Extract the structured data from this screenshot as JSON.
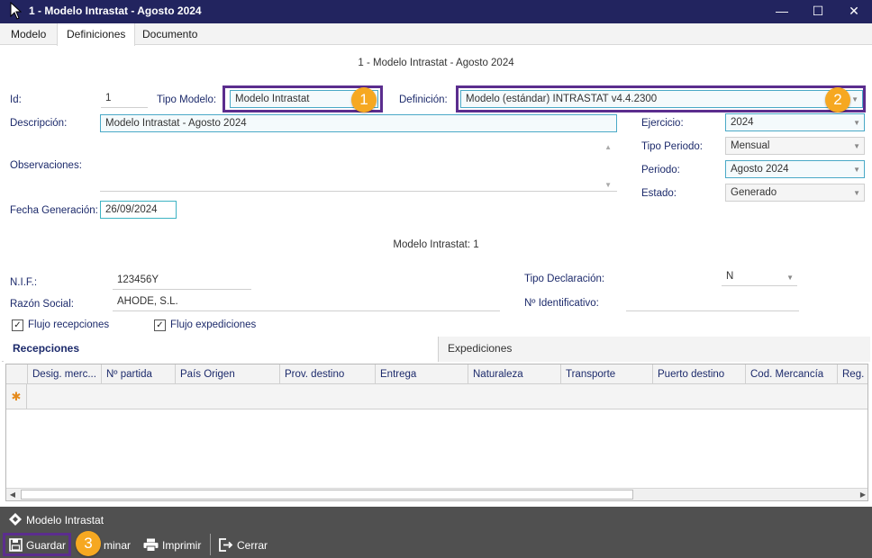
{
  "window": {
    "title": "1 - Modelo Intrastat - Agosto 2024"
  },
  "menu": [
    "Modelo",
    "Definiciones",
    "Documento"
  ],
  "form_title": "1 - Modelo Intrastat - Agosto 2024",
  "fields": {
    "id_label": "Id:",
    "id_value": "1",
    "tipo_modelo_label": "Tipo Modelo:",
    "tipo_modelo_value": "Modelo Intrastat",
    "definicion_label": "Definición:",
    "definicion_value": "Modelo (estándar) INTRASTAT v4.4.2300",
    "descripcion_label": "Descripción:",
    "descripcion_value": "Modelo Intrastat - Agosto 2024",
    "observaciones_label": "Observaciones:",
    "fecha_label": "Fecha Generación:",
    "fecha_value": "26/09/2024",
    "ejercicio_label": "Ejercicio:",
    "ejercicio_value": "2024",
    "tipo_periodo_label": "Tipo Periodo:",
    "tipo_periodo_value": "Mensual",
    "periodo_label": "Periodo:",
    "periodo_value": "Agosto 2024",
    "estado_label": "Estado:",
    "estado_value": "Generado"
  },
  "section_title": "Modelo Intrastat: 1",
  "detail": {
    "nif_label": "N.I.F.:",
    "nif_value": "123456Y",
    "razon_label": "Razón Social:",
    "razon_value": "AHODE, S.L.",
    "tipo_decl_label": "Tipo Declaración:",
    "tipo_decl_value": "N",
    "num_ident_label": "Nº Identificativo:"
  },
  "checkboxes": {
    "recepciones": "Flujo recepciones",
    "expediciones": "Flujo expediciones"
  },
  "tabs": [
    "Recepciones",
    "Expediciones"
  ],
  "grid_columns": [
    "Desig. merc...",
    "Nº partida",
    "País Origen",
    "Prov. destino",
    "Entrega",
    "Naturaleza",
    "Transporte",
    "Puerto destino",
    "Cod. Mercancía",
    "Reg. E"
  ],
  "toolbar": {
    "title": "Modelo Intrastat",
    "guardar": "Guardar",
    "eliminar": "minar",
    "imprimir": "Imprimir",
    "cerrar": "Cerrar"
  },
  "badges": [
    "1",
    "2",
    "3"
  ],
  "colors": {
    "titlebar": "#22245f",
    "highlight": "#5b2d8e",
    "badge": "#f6a821",
    "toolbar": "#505050"
  }
}
